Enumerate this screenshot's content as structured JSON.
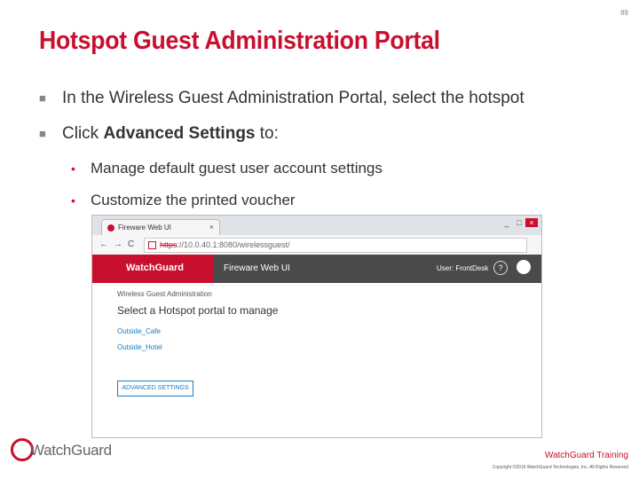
{
  "page_number": "89",
  "title": "Hotspot Guest Administration Portal",
  "bullets": {
    "first": "In the Wireless Guest Administration Portal, select the hotspot",
    "second_prefix": "Click ",
    "second_bold": "Advanced Settings",
    "second_suffix": " to:",
    "sub": [
      "Manage default guest user account settings",
      "Customize the printed voucher"
    ]
  },
  "screenshot": {
    "tab_title": "Fireware Web UI",
    "tab_close": "×",
    "url_scheme": "https",
    "url_rest": "://10.0.40.1:8080/wirelessguest/",
    "nav_back": "←",
    "nav_forward": "→",
    "nav_reload": "C",
    "logo": "WatchGuard",
    "app_name": "Fireware Web UI",
    "user_label": "User: FrontDesk",
    "help": "?",
    "breadcrumb": "Wireless Guest Administration",
    "heading": "Select a Hotspot portal to manage",
    "links": [
      "Outside_Cafe",
      "Outside_Hotel"
    ],
    "advanced_button": "ADVANCED SETTINGS",
    "window_controls": [
      "_",
      "□",
      "×"
    ]
  },
  "footer": {
    "logo_text": "WatchGuard",
    "training": "WatchGuard Training",
    "copyright": "Copyright ©2016 WatchGuard Technologies, Inc. All Rights Reserved"
  },
  "colors": {
    "brand_red": "#c8102e",
    "header_dark": "#4a4a4a",
    "link_blue": "#1a7bbf"
  }
}
